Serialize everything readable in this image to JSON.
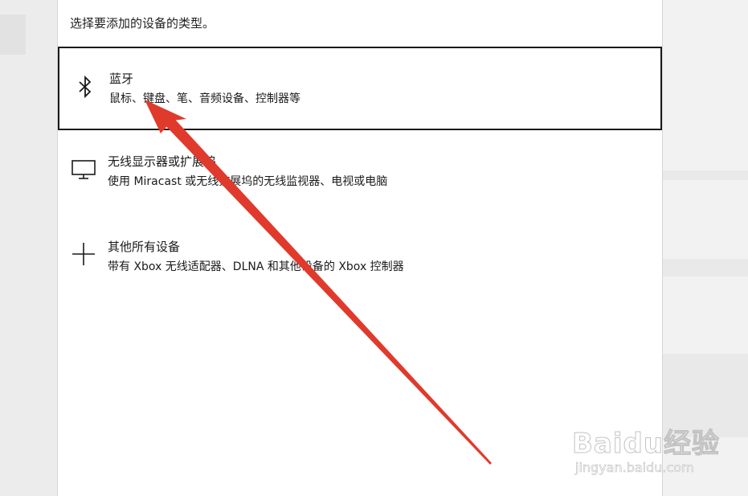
{
  "dialog": {
    "instruction": "选择要添加的设备的类型。",
    "options": [
      {
        "title": "蓝牙",
        "description": "鼠标、键盘、笔、音频设备、控制器等",
        "icon": "bluetooth-icon",
        "selected": true
      },
      {
        "title": "无线显示器或扩展坞",
        "description": "使用 Miracast 或无线扩展坞的无线监视器、电视或电脑",
        "icon": "monitor-icon",
        "selected": false
      },
      {
        "title": "其他所有设备",
        "description": "带有 Xbox 无线适配器、DLNA 和其他设备的 Xbox 控制器",
        "icon": "plus-icon",
        "selected": false
      }
    ]
  },
  "annotation": {
    "arrow_color": "#e03a2c"
  },
  "watermark": {
    "brand": "Baidu经验",
    "url": "jingyan.baidu.com"
  }
}
